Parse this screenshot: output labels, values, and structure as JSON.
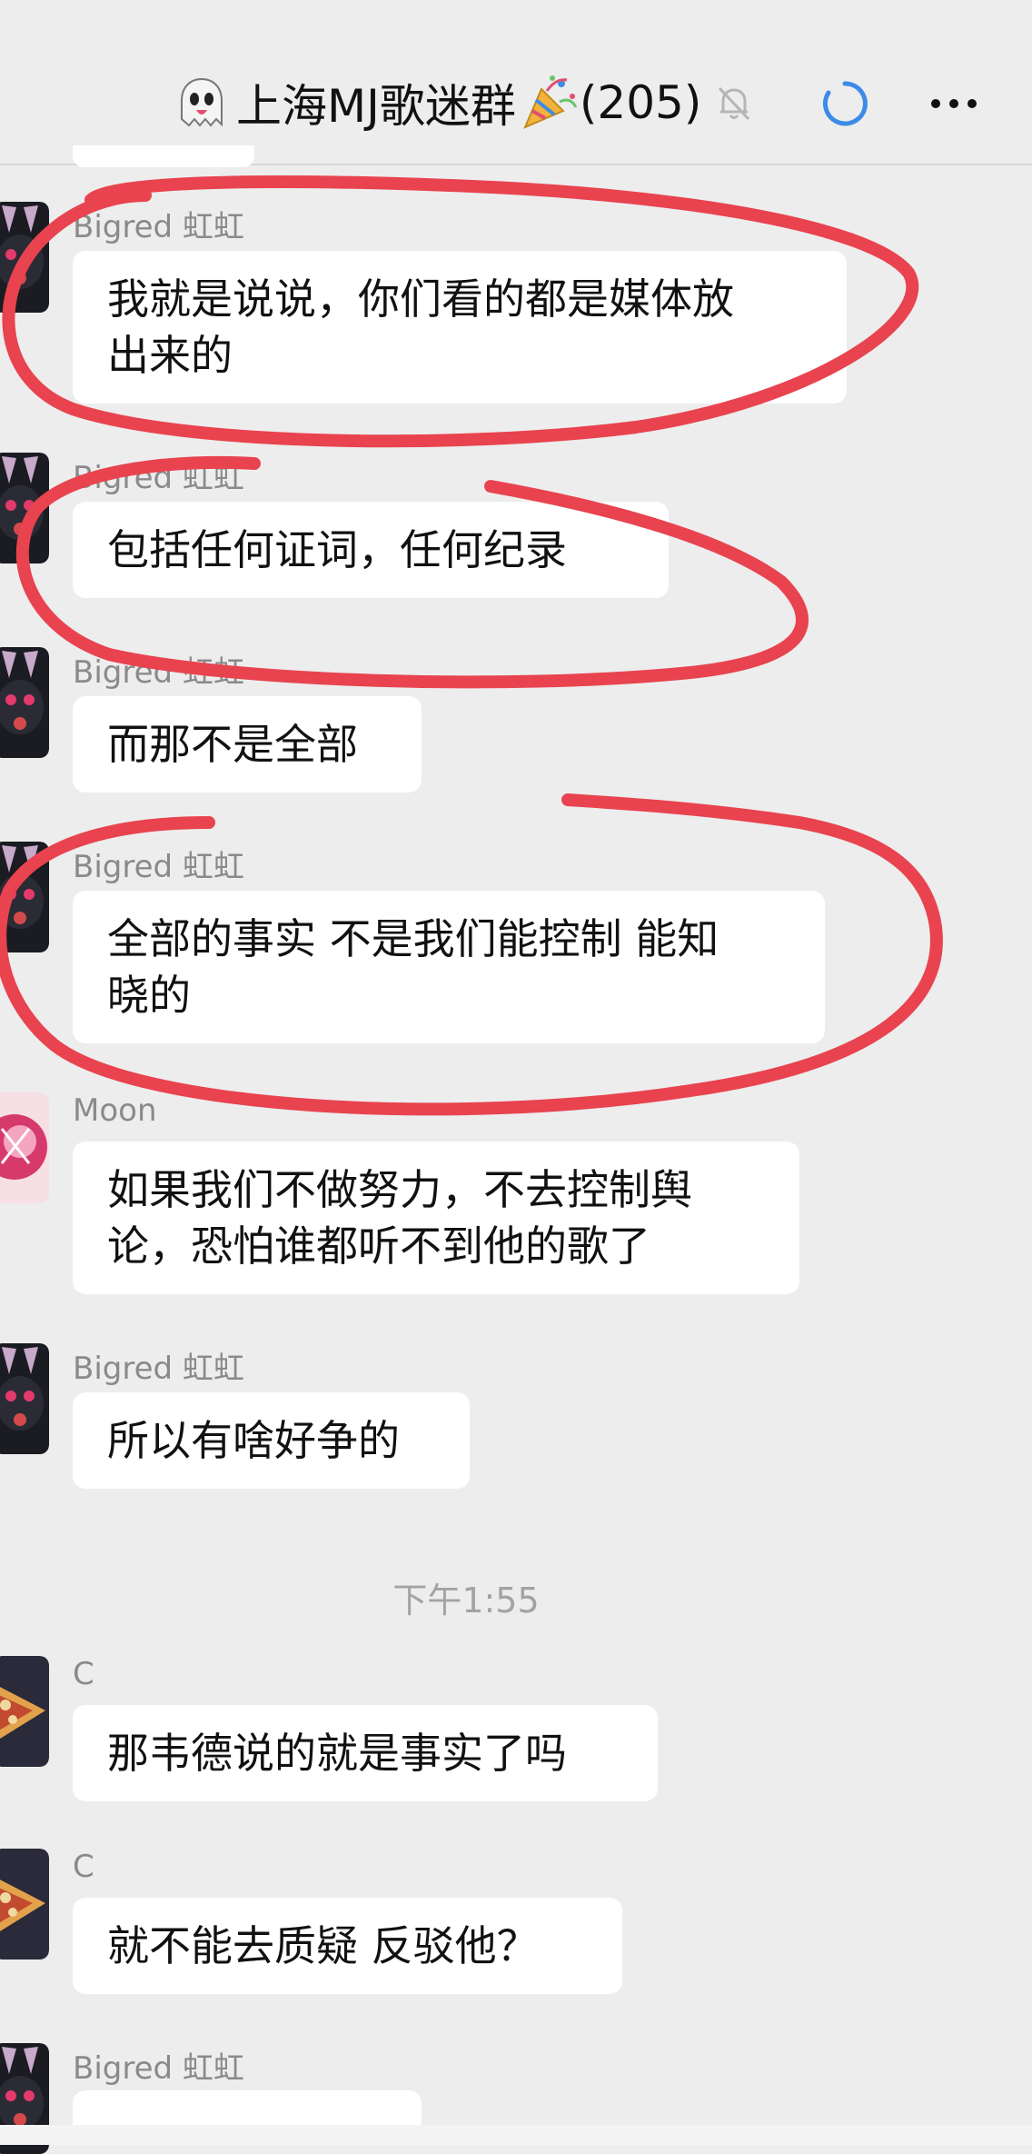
{
  "header": {
    "title": "上海MJ歌迷群",
    "member_count": "(205)",
    "icons": [
      "ghost-icon",
      "party-popper-icon",
      "mute-bell-icon",
      "loading-icon",
      "more-icon"
    ]
  },
  "messages": [
    {
      "sender": "Bigred 虹虹",
      "lines": [
        "我就是说说，你们看的都是媒体放",
        "出来的"
      ]
    },
    {
      "sender": "Bigred 虹虹",
      "lines": [
        "包括任何证词，任何纪录"
      ]
    },
    {
      "sender": "Bigred 虹虹",
      "lines": [
        "而那不是全部"
      ]
    },
    {
      "sender": "Bigred 虹虹",
      "lines": [
        "全部的事实 不是我们能控制 能知",
        "晓的"
      ]
    },
    {
      "sender": "Moon",
      "lines": [
        "如果我们不做努力，不去控制舆",
        "论，恐怕谁都听不到他的歌了"
      ]
    },
    {
      "sender": "Bigred 虹虹",
      "lines": [
        "所以有啥好争的"
      ]
    },
    {
      "sender": "C",
      "lines": [
        "那韦德说的就是事实了吗"
      ]
    },
    {
      "sender": "C",
      "lines": [
        "就不能去质疑 反驳他？"
      ]
    },
    {
      "sender": "Bigred 虹虹",
      "lines": []
    }
  ],
  "time_separator": "下午1:55",
  "colors": {
    "background": "#ededed",
    "bubble": "#ffffff",
    "annotation_red": "#e8434f",
    "loading_blue": "#3d8be6"
  }
}
